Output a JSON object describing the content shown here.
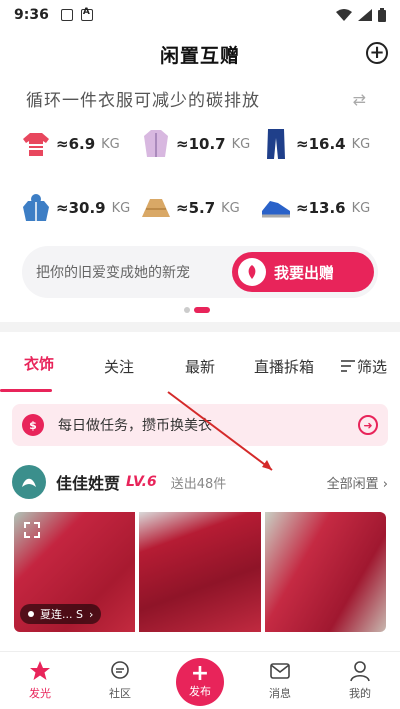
{
  "status_bar": {
    "time": "9:36"
  },
  "header": {
    "title": "闲置互赠"
  },
  "carbon": {
    "title": "循环一件衣服可减少的碳排放",
    "unit": "KG",
    "items": [
      {
        "icon": "sweater-icon",
        "value": "≈6.9"
      },
      {
        "icon": "coat-icon",
        "value": "≈10.7"
      },
      {
        "icon": "jeans-icon",
        "value": "≈16.4"
      },
      {
        "icon": "jacket-icon",
        "value": "≈30.9"
      },
      {
        "icon": "skirt-icon",
        "value": "≈5.7"
      },
      {
        "icon": "sneakers-icon",
        "value": "≈13.6"
      }
    ],
    "gift_placeholder": "把你的旧爱变成她的新宠",
    "gift_button": "我要出赠"
  },
  "tabs": [
    "衣饰",
    "关注",
    "最新",
    "直播拆箱",
    "筛选"
  ],
  "task": {
    "text": "每日做任务，攒币换美衣"
  },
  "user": {
    "name": "佳佳姓贾",
    "level": "LV.6",
    "given": "送出48件",
    "all_idle": "全部闲置"
  },
  "photo_tag": "夏连... S",
  "nav": [
    {
      "label": "发光",
      "icon": "star-icon"
    },
    {
      "label": "社区",
      "icon": "chat-icon"
    },
    {
      "label": "发布",
      "icon": "plus-icon"
    },
    {
      "label": "消息",
      "icon": "mail-icon"
    },
    {
      "label": "我的",
      "icon": "person-icon"
    }
  ],
  "colors": {
    "accent": "#e8245a"
  }
}
